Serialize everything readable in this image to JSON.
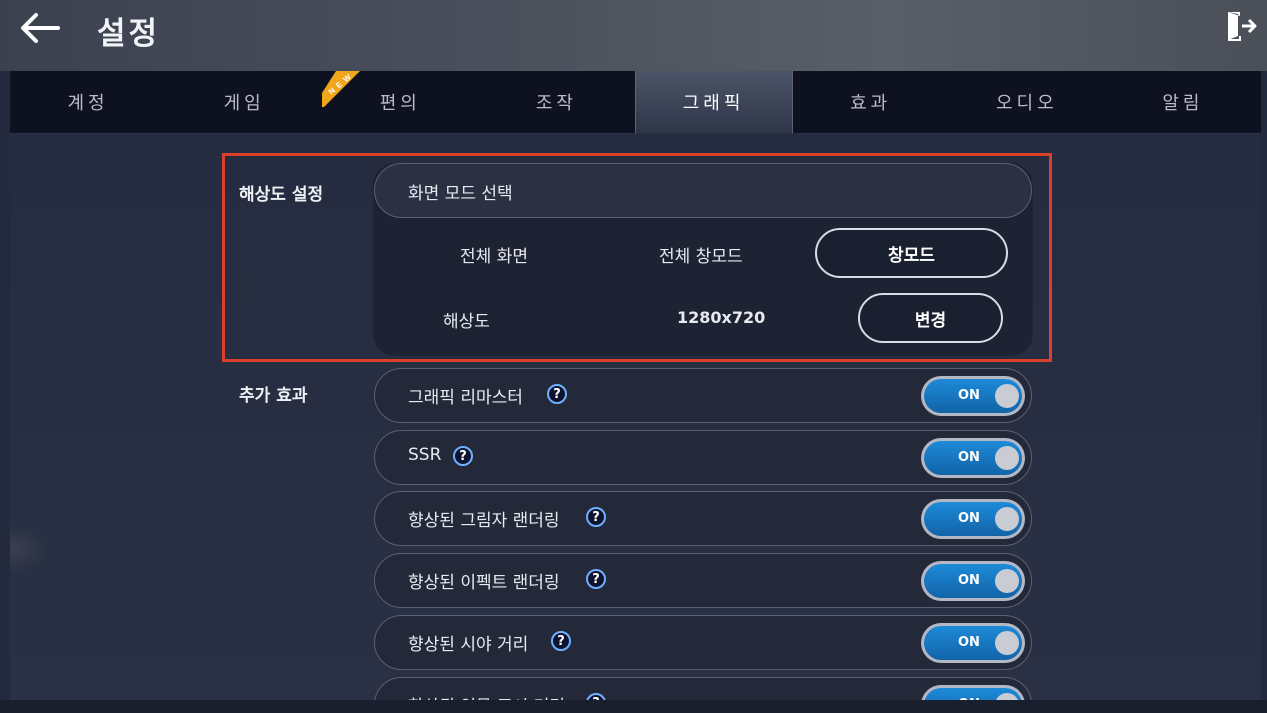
{
  "header": {
    "title": "설정",
    "back_icon": "arrow-left-icon",
    "exit_icon": "exit-door-icon"
  },
  "tabs": [
    {
      "label": "계정",
      "active": false
    },
    {
      "label": "게임",
      "active": false,
      "badge": "NEW"
    },
    {
      "label": "편의",
      "active": false
    },
    {
      "label": "조작",
      "active": false
    },
    {
      "label": "그래픽",
      "active": true
    },
    {
      "label": "효과",
      "active": false
    },
    {
      "label": "오디오",
      "active": false
    },
    {
      "label": "알림",
      "active": false
    }
  ],
  "resolution_section": {
    "label": "해상도 설정",
    "screen_mode_header": "화면 모드 선택",
    "modes": [
      "전체 화면",
      "전체 창모드",
      "창모드"
    ],
    "selected_mode": "창모드",
    "resolution_label": "해상도",
    "resolution_value": "1280x720",
    "change_button": "변경"
  },
  "effects_section": {
    "label": "추가 효과",
    "items": [
      {
        "label": "그래픽 리마스터",
        "toggle": "ON"
      },
      {
        "label": "SSR",
        "toggle": "ON"
      },
      {
        "label": "향상된 그림자 랜더링",
        "toggle": "ON"
      },
      {
        "label": "향상된 이펙트 랜더링",
        "toggle": "ON"
      },
      {
        "label": "향상된 시야 거리",
        "toggle": "ON"
      },
      {
        "label": "향상된 인물 표시 거리",
        "toggle": "ON"
      }
    ],
    "help_symbol": "?"
  },
  "colors": {
    "highlight": "#d9412b",
    "toggle_on": "#1d8ad8",
    "badge": "#f0a51a"
  }
}
